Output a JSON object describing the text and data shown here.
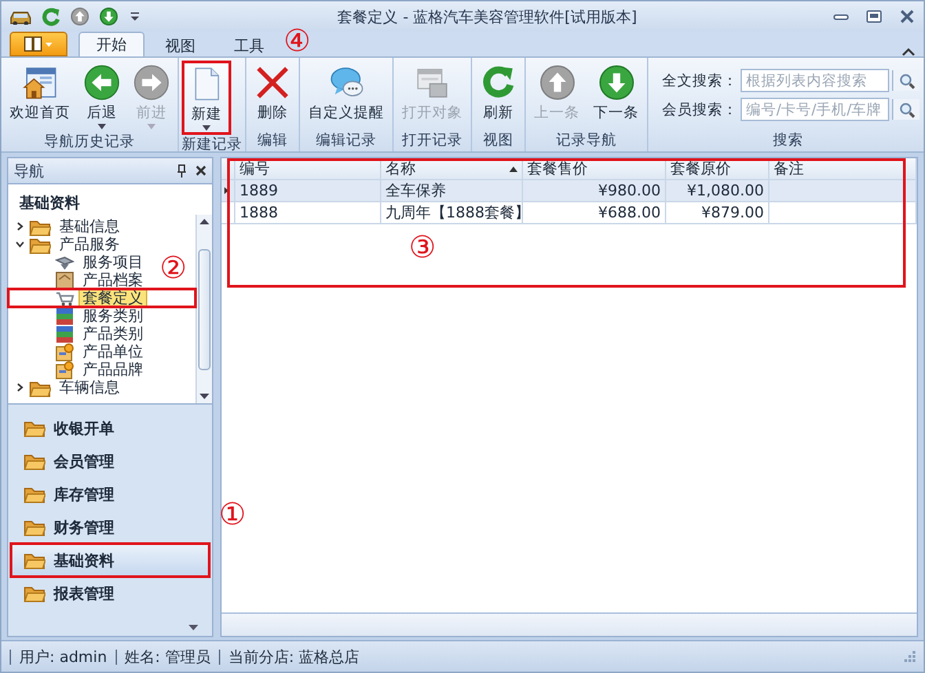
{
  "window": {
    "title": "套餐定义 - 蓝格汽车美容管理软件[试用版本]"
  },
  "tabs": [
    {
      "label": "开始",
      "selected": true
    },
    {
      "label": "视图",
      "selected": false
    },
    {
      "label": "工具",
      "selected": false
    }
  ],
  "ribbon": {
    "groups": [
      {
        "label": "导航历史记录",
        "buttons": [
          {
            "label": "欢迎首页",
            "kind": "home",
            "disabled": false,
            "dropdown": false,
            "highlight": false
          },
          {
            "label": "后退",
            "kind": "back",
            "disabled": false,
            "dropdown": true,
            "highlight": false
          },
          {
            "label": "前进",
            "kind": "forward",
            "disabled": true,
            "dropdown": true,
            "highlight": false
          }
        ]
      },
      {
        "label": "新建记录",
        "buttons": [
          {
            "label": "新建",
            "kind": "new",
            "disabled": false,
            "dropdown": true,
            "highlight": true,
            "marker": "④"
          }
        ]
      },
      {
        "label": "编辑",
        "buttons": [
          {
            "label": "删除",
            "kind": "delete",
            "disabled": false,
            "dropdown": false,
            "highlight": false
          }
        ]
      },
      {
        "label": "编辑记录",
        "buttons": [
          {
            "label": "自定义提醒",
            "kind": "chat",
            "disabled": false,
            "dropdown": false,
            "highlight": false
          }
        ]
      },
      {
        "label": "打开记录",
        "buttons": [
          {
            "label": "打开对象",
            "kind": "open",
            "disabled": true,
            "dropdown": false,
            "highlight": false
          }
        ]
      },
      {
        "label": "视图",
        "buttons": [
          {
            "label": "刷新",
            "kind": "refresh",
            "disabled": false,
            "dropdown": false,
            "highlight": false
          }
        ]
      },
      {
        "label": "记录导航",
        "buttons": [
          {
            "label": "上一条",
            "kind": "up",
            "disabled": true,
            "dropdown": false,
            "highlight": false
          },
          {
            "label": "下一条",
            "kind": "down",
            "disabled": false,
            "dropdown": false,
            "highlight": false
          }
        ]
      }
    ],
    "search": {
      "label": "搜索",
      "fields": [
        {
          "label": "全文搜索：",
          "placeholder": "根据列表内容搜索"
        },
        {
          "label": "会员搜索：",
          "placeholder": "编号/卡号/手机/车牌"
        }
      ]
    }
  },
  "nav": {
    "title": "导航",
    "section": "基础资料",
    "tree": [
      {
        "label": "基础信息",
        "kind": "folder",
        "expanded": false,
        "selected": false,
        "highlight": false
      },
      {
        "label": "产品服务",
        "kind": "folder",
        "expanded": true,
        "selected": false,
        "highlight": false,
        "children": [
          {
            "label": "服务项目",
            "kind": "service",
            "selected": false,
            "highlight": false
          },
          {
            "label": "产品档案",
            "kind": "archive",
            "selected": false,
            "highlight": false
          },
          {
            "label": "套餐定义",
            "kind": "cart",
            "selected": true,
            "highlight": true,
            "marker": "②"
          },
          {
            "label": "服务类别",
            "kind": "category",
            "selected": false,
            "highlight": false
          },
          {
            "label": "产品类别",
            "kind": "category",
            "selected": false,
            "highlight": false
          },
          {
            "label": "产品单位",
            "kind": "unit",
            "selected": false,
            "highlight": false
          },
          {
            "label": "产品品牌",
            "kind": "unit",
            "selected": false,
            "highlight": false
          }
        ]
      },
      {
        "label": "车辆信息",
        "kind": "folder",
        "expanded": false,
        "selected": false,
        "highlight": false
      }
    ],
    "bar_items": [
      {
        "label": "收银开单",
        "selected": false,
        "highlight": false
      },
      {
        "label": "会员管理",
        "selected": false,
        "highlight": false
      },
      {
        "label": "库存管理",
        "selected": false,
        "highlight": false
      },
      {
        "label": "财务管理",
        "selected": false,
        "highlight": false
      },
      {
        "label": "基础资料",
        "selected": true,
        "highlight": true,
        "marker": "①"
      },
      {
        "label": "报表管理",
        "selected": false,
        "highlight": false
      }
    ]
  },
  "grid": {
    "highlight": true,
    "marker": "③",
    "columns": [
      {
        "label": "编号",
        "sorted": false
      },
      {
        "label": "名称",
        "sorted": true
      },
      {
        "label": "套餐售价",
        "sorted": false
      },
      {
        "label": "套餐原价",
        "sorted": false
      },
      {
        "label": "备注",
        "sorted": false
      }
    ],
    "rows": [
      {
        "cells": [
          "1889",
          " 全车保养",
          "¥980.00",
          "¥1,080.00"
        ],
        "selected": true
      },
      {
        "cells": [
          "1888",
          "九周年【1888套餐】",
          "¥688.00",
          "¥879.00"
        ],
        "selected": false
      }
    ]
  },
  "status_bar": {
    "items": [
      "用户: admin",
      "姓名: 管理员",
      "当前分店: 蓝格总店"
    ]
  }
}
